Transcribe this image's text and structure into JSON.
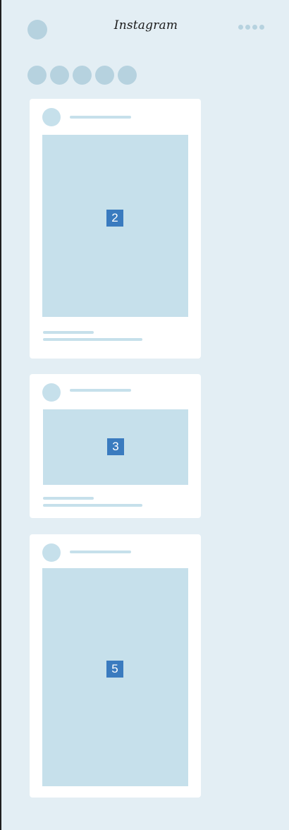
{
  "header": {
    "logo_text": "Instagram",
    "profile_icon": "avatar-circle-icon",
    "more_icon": "dots-menu-icon"
  },
  "stories": {
    "count": 5,
    "icon": "story-circle-icon"
  },
  "feed": {
    "posts": [
      {
        "badge": "2"
      },
      {
        "badge": "3"
      },
      {
        "badge": "5"
      }
    ]
  },
  "colors": {
    "background": "#e3eef4",
    "placeholder": "#c6e0eb",
    "placeholder_dark": "#b6d2df",
    "card": "#ffffff",
    "badge": "#3a7bbf",
    "badge_text": "#ffffff",
    "border": "#1f1f1f"
  }
}
